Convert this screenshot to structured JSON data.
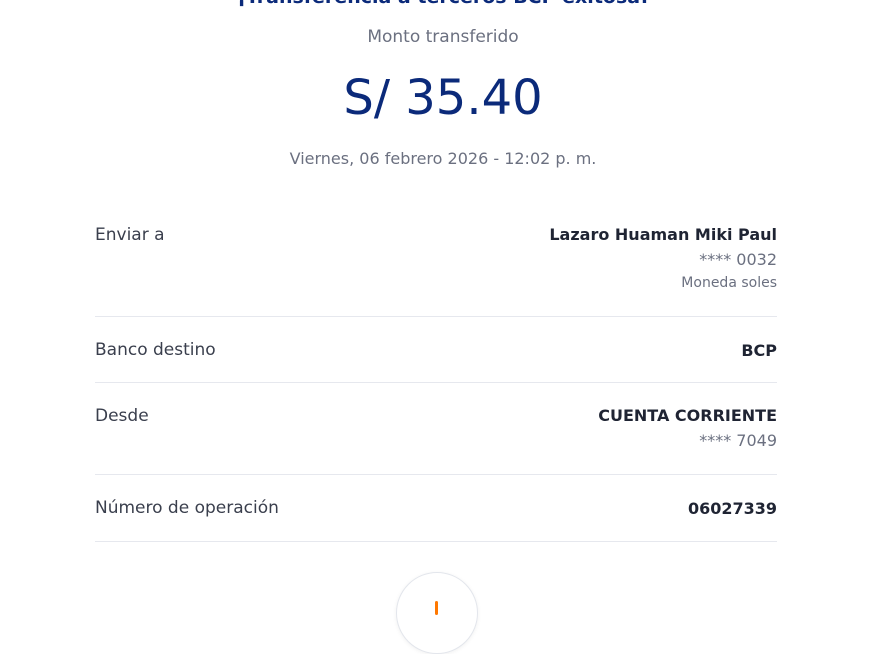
{
  "header": {
    "title": "¡Transferencia a terceros BCP exitosa!",
    "amount_label": "Monto transferido",
    "amount": "S/ 35.40",
    "datetime": "Viernes, 06 febrero 2026 - 12:02 p. m."
  },
  "details": {
    "send_to": {
      "label": "Enviar a",
      "name": "Lazaro Huaman Miki Paul",
      "account": "**** 0032",
      "currency": "Moneda soles"
    },
    "bank": {
      "label": "Banco destino",
      "value": "BCP"
    },
    "from": {
      "label": "Desde",
      "account_type": "CUENTA CORRIENTE",
      "account": "**** 7049"
    },
    "operation": {
      "label": "Número de operación",
      "value": "06027339"
    }
  },
  "colors": {
    "primary": "#0b2a7a",
    "accent": "#ff7800",
    "muted": "#6b7080"
  },
  "icons": {
    "fab_icon": "download-icon"
  }
}
